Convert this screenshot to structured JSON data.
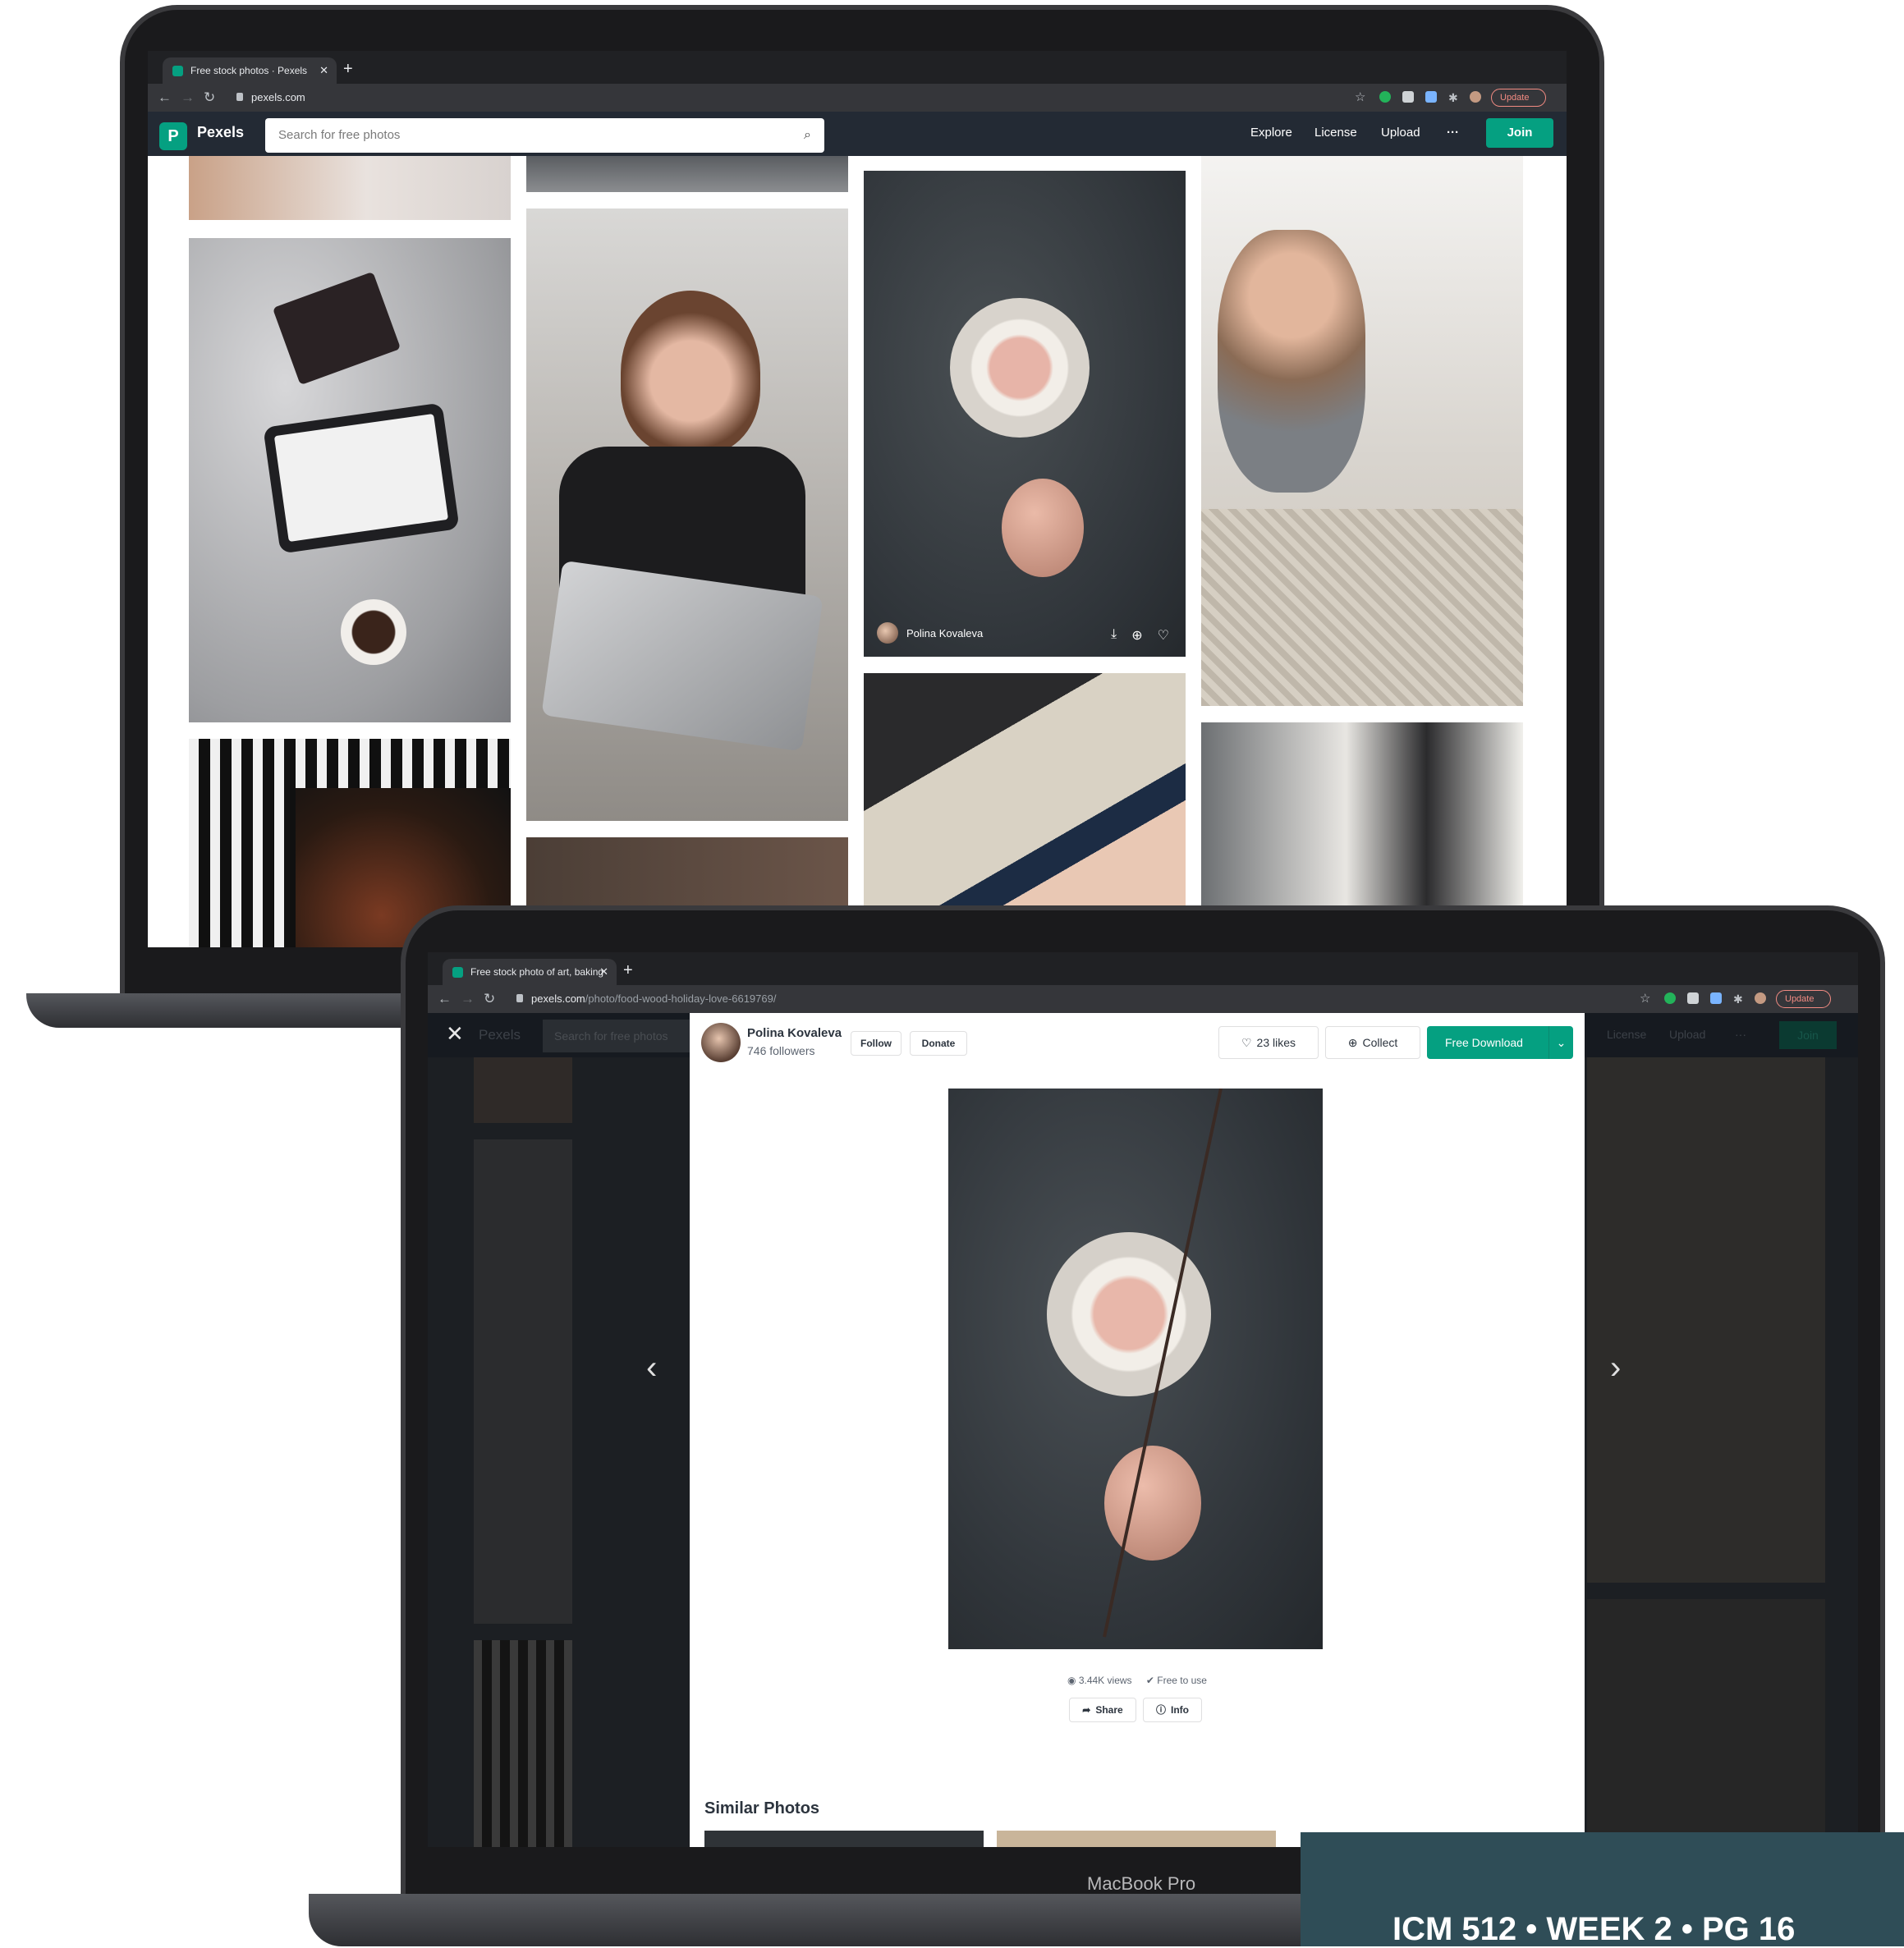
{
  "back_window": {
    "tab_title": "Free stock photos · Pexels",
    "url": "pexels.com",
    "update_label": "Update",
    "brand": "Pexels",
    "search_placeholder": "Search for free photos",
    "nav": {
      "explore": "Explore",
      "license": "License",
      "upload": "Upload",
      "more": "···",
      "join": "Join"
    },
    "hover_photographer": "Polina Kovaleva"
  },
  "front_window": {
    "tab_title": "Free stock photo of art, baking",
    "url_host": "pexels.com",
    "url_path": "/photo/food-wood-holiday-love-6619769/",
    "update_label": "Update",
    "bg_brand": "Pexels",
    "bg_search": "Search for free photos",
    "bg_nav": {
      "license": "License",
      "upload": "Upload",
      "more": "···",
      "join": "Join"
    },
    "photographer": {
      "name": "Polina Kovaleva",
      "followers": "746 followers"
    },
    "follow_label": "Follow",
    "donate_label": "Donate",
    "likes_label": "23 likes",
    "collect_label": "Collect",
    "download_label": "Free Download",
    "views_label": "3.44K views",
    "free_label": "Free to use",
    "share_label": "Share",
    "info_label": "Info",
    "similar_title": "Similar Photos",
    "device_label": "MacBook Pro"
  },
  "banner": {
    "text": "ICM 512 • WEEK 2 • PG 16"
  },
  "colors": {
    "pexels_green": "#05a081",
    "header_dark": "#232a34",
    "banner": "#2f4d57"
  },
  "icons": [
    "search-icon",
    "back-icon",
    "forward-icon",
    "reload-icon",
    "lock-icon",
    "star-icon",
    "heart-icon",
    "plus-circle-icon",
    "download-icon",
    "close-icon",
    "chevron-left-icon",
    "chevron-right-icon",
    "eye-icon",
    "check-icon",
    "share-icon",
    "info-icon",
    "chevron-down-icon"
  ]
}
